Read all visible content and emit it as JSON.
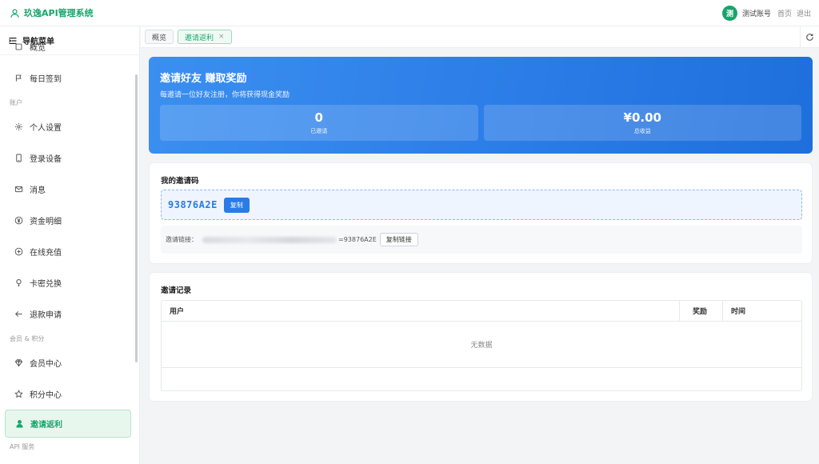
{
  "header": {
    "brand": "玖逸API管理系统",
    "avatar_text": "测",
    "username": "测试账号",
    "home_link": "首页",
    "logout_link": "退出"
  },
  "sidebar": {
    "title": "导航菜单",
    "items": [
      {
        "type": "item",
        "label": "概览",
        "icon": "square-icon"
      },
      {
        "type": "item",
        "label": "每日签到",
        "icon": "flag-icon"
      },
      {
        "type": "group",
        "label": "账户"
      },
      {
        "type": "item",
        "label": "个人设置",
        "icon": "gear-icon"
      },
      {
        "type": "item",
        "label": "登录设备",
        "icon": "phone-icon"
      },
      {
        "type": "item",
        "label": "消息",
        "icon": "mail-icon"
      },
      {
        "type": "item",
        "label": "资金明细",
        "icon": "yen-icon"
      },
      {
        "type": "item",
        "label": "在线充值",
        "icon": "plus-circle-icon"
      },
      {
        "type": "item",
        "label": "卡密兑换",
        "icon": "bulb-icon"
      },
      {
        "type": "item",
        "label": "退款申请",
        "icon": "arrow-left-icon"
      },
      {
        "type": "group",
        "label": "会员 & 积分"
      },
      {
        "type": "item",
        "label": "会员中心",
        "icon": "diamond-icon"
      },
      {
        "type": "item",
        "label": "积分中心",
        "icon": "star-icon"
      },
      {
        "type": "item",
        "label": "邀请返利",
        "icon": "user-icon",
        "active": true
      },
      {
        "type": "group",
        "label": "API 服务"
      }
    ]
  },
  "tabs": [
    {
      "label": "概览",
      "active": false
    },
    {
      "label": "邀请返利",
      "active": true
    }
  ],
  "banner": {
    "title": "邀请好友 赚取奖励",
    "subtitle": "每邀请一位好友注册，你将获得现金奖励",
    "invited_value": "0",
    "invited_label": "已邀请",
    "earnings_value": "¥0.00",
    "earnings_label": "总收益"
  },
  "invite_code": {
    "title": "我的邀请码",
    "code": "93876A2E",
    "copy_label": "复制",
    "link_label": "邀请链接：",
    "link_suffix": "=93876A2E",
    "copy_link_label": "复制链接"
  },
  "records": {
    "title": "邀请记录",
    "columns": [
      "用户",
      "奖励",
      "时间"
    ],
    "empty_text": "无数据"
  },
  "colors": {
    "brand_green": "#17a66b",
    "banner_blue": "#2a7be6"
  }
}
